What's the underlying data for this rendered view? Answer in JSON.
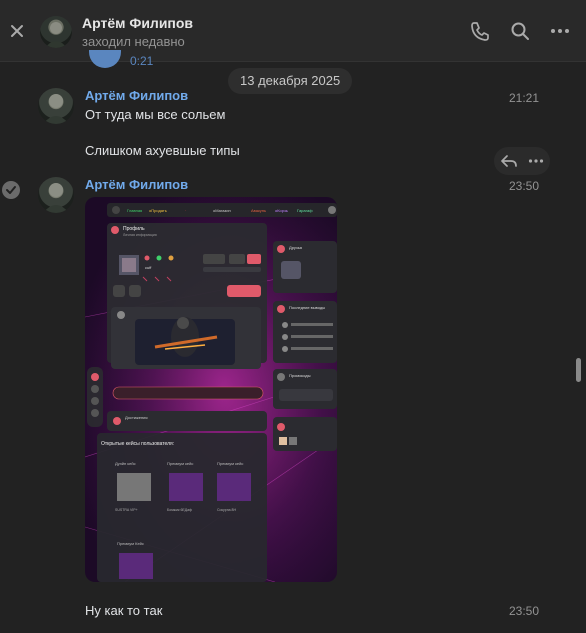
{
  "header": {
    "name": "Артём Филипов",
    "status": "заходил недавно"
  },
  "stub": {
    "time": "0:21"
  },
  "date_separator": "13 декабря 2025",
  "messages": [
    {
      "sender": "Артём Филипов",
      "text": "От туда мы все сольем",
      "time": "21:21"
    },
    {
      "text": "Слишком ахуевшые типы"
    },
    {
      "sender": "Артём Филипов",
      "time": "23:50",
      "attachment": "screenshot"
    },
    {
      "text": "Ну как то так",
      "time": "23:50"
    }
  ],
  "screenshot": {
    "nav": [
      "Главная",
      "оПродать",
      "",
      "оМагазин",
      "Aвакунь",
      "оКорзь",
      "Гарагаф"
    ],
    "profile_title": "Профиль",
    "profile_sub": "Личная информация",
    "username": "сuff",
    "friends_title": "Друзья",
    "friends_sub": "Пользователи",
    "recent_title": "Последние выводы",
    "recent_items": [
      "Заявка на вывод без",
      "нам нас на вывод",
      "нам нас на изменение"
    ],
    "promo_title": "Промокоды",
    "cases_title": "Открытые кейсы пользователя:",
    "case_names": [
      "Дуэйн кейс",
      "Премиум кейс",
      "Премиум кейс",
      "Премиум Кейс"
    ],
    "case_captions": [
      "SUSTRA VIP+",
      "Бомжик 6ЕДаф",
      "Сокурна 8Н"
    ],
    "button_label": "",
    "pink_button": ""
  },
  "colors": {
    "sender": "#71aaeb",
    "accent": "#5a86bf",
    "screenshot_pink": "#e05a6a"
  }
}
